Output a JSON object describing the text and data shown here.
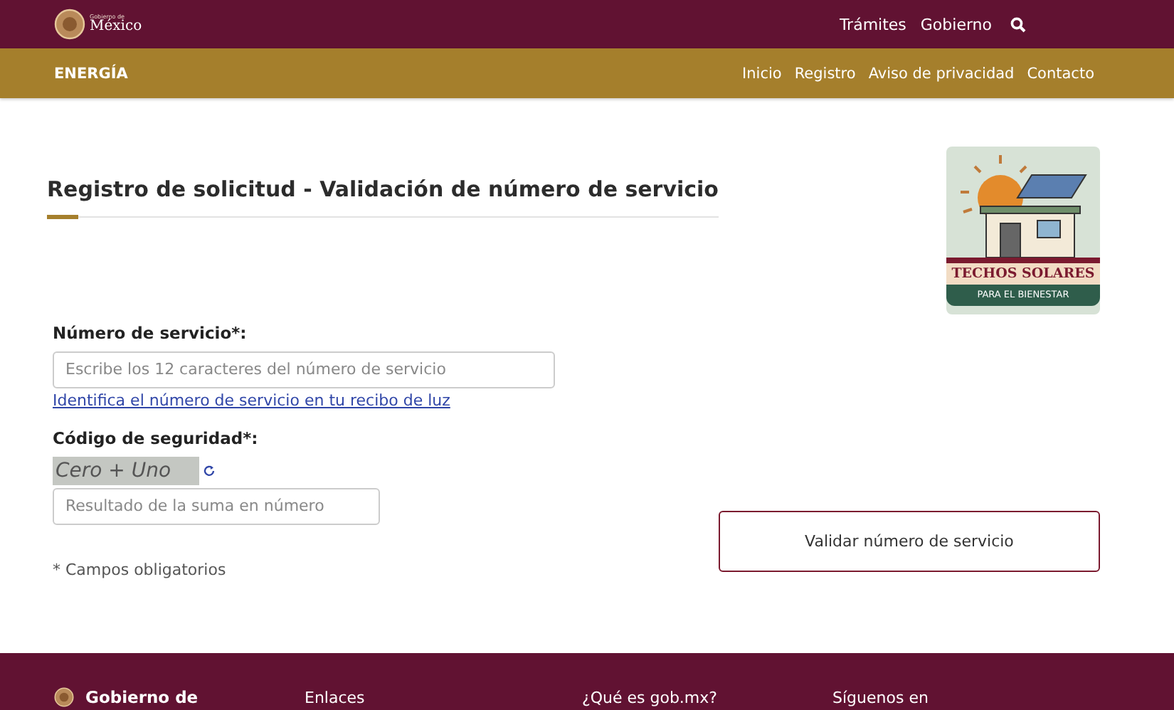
{
  "header": {
    "logo_line_1": "Gobierno de",
    "logo_line_2": "México",
    "links": [
      "Trámites",
      "Gobierno"
    ]
  },
  "subnav": {
    "site": "ENERGÍA",
    "links": [
      "Inicio",
      "Registro",
      "Aviso de privacidad",
      "Contacto"
    ]
  },
  "page_title": "Registro de solicitud - Validación de número de servicio",
  "badge": {
    "title": "TECHOS SOLARES",
    "subtitle": "PARA EL BIENESTAR"
  },
  "form": {
    "service_label": "Número de servicio*:",
    "service_placeholder": "Escribe los 12 caracteres del número de servicio",
    "service_help_link": "Identifica el número de servicio en tu recibo de luz",
    "captcha_label": "Código de seguridad*:",
    "captcha_text": "Cero + Uno",
    "captcha_placeholder": "Resultado de la suma en número",
    "required_note": "* Campos obligatorios",
    "submit": "Validar número de servicio"
  },
  "footer": {
    "brand": "Gobierno de",
    "columns": [
      "Enlaces",
      "¿Qué es gob.mx?",
      "Síguenos en"
    ]
  }
}
